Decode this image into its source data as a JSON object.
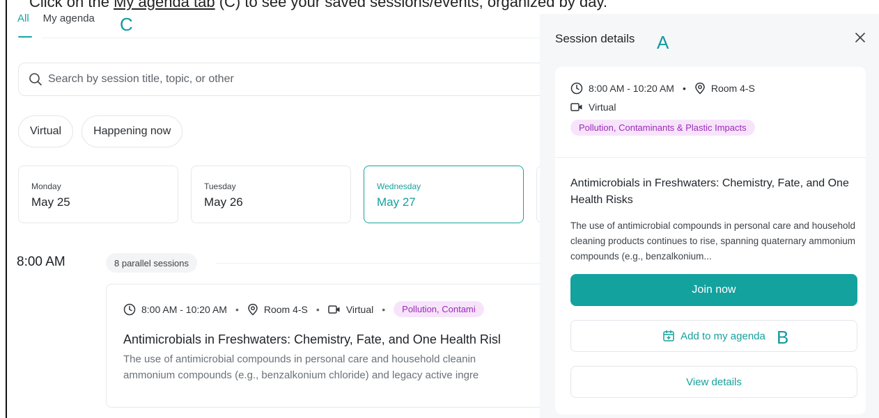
{
  "caption": {
    "prefix": "Click on the ",
    "link": "My agenda tab",
    "suffix": " (C) to see your saved sessions/events, organized by day."
  },
  "annotations": {
    "a": "A",
    "b": "B",
    "c": "C"
  },
  "tabs": [
    {
      "label": "All",
      "active": true
    },
    {
      "label": "My agenda",
      "active": false
    }
  ],
  "search": {
    "placeholder": "Search by session title, topic, or other"
  },
  "filters": [
    "Virtual",
    "Happening now"
  ],
  "days": [
    {
      "name": "Monday",
      "date": "May 25"
    },
    {
      "name": "Tuesday",
      "date": "May 26"
    },
    {
      "name": "Wednesday",
      "date": "May 27",
      "selected": true
    }
  ],
  "timeslot": {
    "time": "8:00 AM",
    "parallel": "8 parallel sessions"
  },
  "session": {
    "time": "8:00 AM - 10:20 AM",
    "room": "Room 4-S",
    "mode": "Virtual",
    "tag": "Pollution, Contaminants & Plastic Impacts",
    "tag_visible": "Pollution, Contami",
    "title": "Antimicrobials in Freshwaters: Chemistry, Fate, and One Health Risl",
    "desc_line1": "The use of antimicrobial compounds in personal care and household cleanin",
    "desc_line2": "ammonium compounds (e.g., benzalkonium chloride) and legacy active ingre"
  },
  "panel": {
    "title": "Session details",
    "time": "8:00 AM - 10:20 AM",
    "room": "Room 4-S",
    "mode": "Virtual",
    "tag": "Pollution, Contaminants & Plastic Impacts",
    "session_title": "Antimicrobials in Freshwaters: Chemistry, Fate, and One Health Risks",
    "description": "The use of antimicrobial compounds in personal care and household cleaning products continues to rise, spanning quaternary ammonium compounds (e.g., benzalkonium...",
    "join_label": "Join now",
    "add_label": "Add to my agenda",
    "view_label": "View details"
  },
  "colors": {
    "accent": "#13a29e",
    "tag_bg": "#f7e4fb",
    "tag_text": "#9a2ab7",
    "annotation": "#1399a1"
  }
}
